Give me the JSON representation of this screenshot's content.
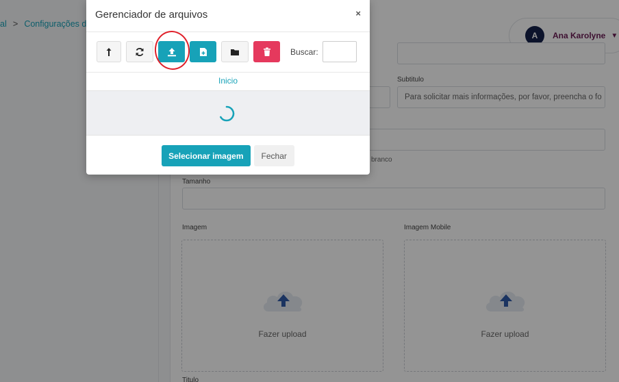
{
  "breadcrumb": {
    "item_1": "al",
    "item_2": "Configurações de s"
  },
  "user": {
    "initial": "A",
    "name": "Ana Karolyne"
  },
  "form": {
    "subtitle_label": "Subtitulo",
    "subtitle_value": "Para solicitar mais informações, por favor, preencha o fo",
    "hint_fragment": "branco",
    "size_label": "Tamanho",
    "image_label": "Imagem",
    "image_mobile_label": "Imagem Mobile",
    "upload_text": "Fazer upload",
    "title_label": "Titulo"
  },
  "modal": {
    "title": "Gerenciador de arquivos",
    "close": "×",
    "search_label": "Buscar:",
    "path": "Inicio",
    "select_button": "Selecionar imagem",
    "close_button": "Fechar"
  },
  "icons": {
    "level_up": "level-up-icon",
    "refresh": "refresh-icon",
    "upload": "upload-icon",
    "new_file": "new-file-icon",
    "folder": "folder-icon",
    "trash": "trash-icon",
    "spinner": "spinner-icon",
    "cloud_upload": "cloud-upload-icon"
  },
  "colors": {
    "accent": "#17a2b8",
    "danger": "#e5395d",
    "user_name": "#6a1b54",
    "avatar": "#16214a",
    "highlight": "#e0202a"
  }
}
